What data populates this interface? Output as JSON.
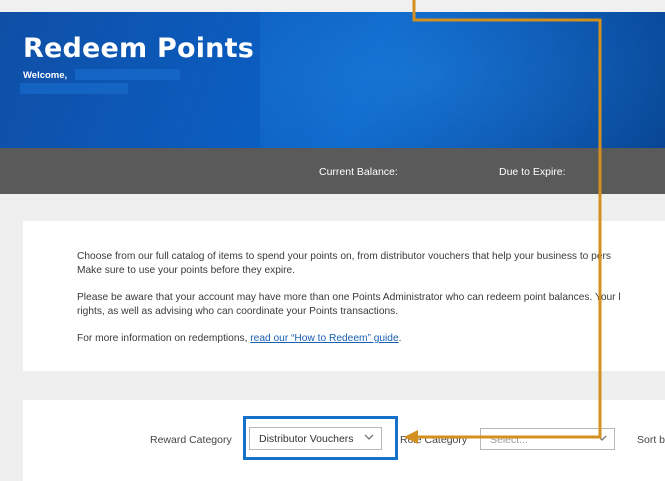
{
  "hero": {
    "title": "Redeem Points",
    "welcome": "Welcome,"
  },
  "balance_bar": {
    "current_balance_label": "Current Balance:",
    "due_to_expire_label": "Due to Expire:"
  },
  "info": {
    "p1_line1": "Choose from our full catalog of items to spend your points on, from distributor vouchers that help your business to pers",
    "p1_line2": "Make sure to use your points before they expire.",
    "p2_line1": "Please be aware that your account may have more than one Points Administrator who can redeem point balances. Your l",
    "p2_line2": "rights, as well as advising who can coordinate your Points transactions.",
    "p3_prefix": "For more information on redemptions, ",
    "p3_link": "read our “How to Redeem” guide",
    "p3_suffix": "."
  },
  "filters": {
    "reward_category_label": "Reward Category",
    "reward_category_value": "Distributor Vouchers",
    "role_category_label": "Role Category",
    "role_category_placeholder": "Select...",
    "sort_label": "Sort b"
  },
  "colors": {
    "hero_blue": "#0b5bbd",
    "balance_bar": "#5a5a5a",
    "highlight_box": "#1570c9",
    "annotation_arrow": "#d4901e",
    "link": "#1a5fb4"
  }
}
